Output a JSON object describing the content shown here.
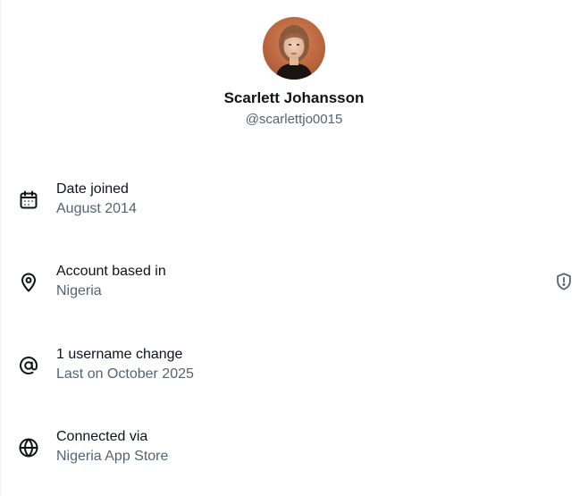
{
  "profile": {
    "display_name": "Scarlett Johansson",
    "handle": "@scarlettjo0015"
  },
  "rows": [
    {
      "icon": "calendar-icon",
      "title": "Date joined",
      "value": "August 2014"
    },
    {
      "icon": "location-pin-icon",
      "title": "Account based in",
      "value": "Nigeria"
    },
    {
      "icon": "at-sign-icon",
      "title": "1 username change",
      "value": "Last on October 2025"
    },
    {
      "icon": "globe-icon",
      "title": "Connected via",
      "value": "Nigeria App Store"
    }
  ],
  "colors": {
    "primary_text": "#0f1419",
    "secondary_text": "#536471",
    "divider": "#eff3f4"
  }
}
